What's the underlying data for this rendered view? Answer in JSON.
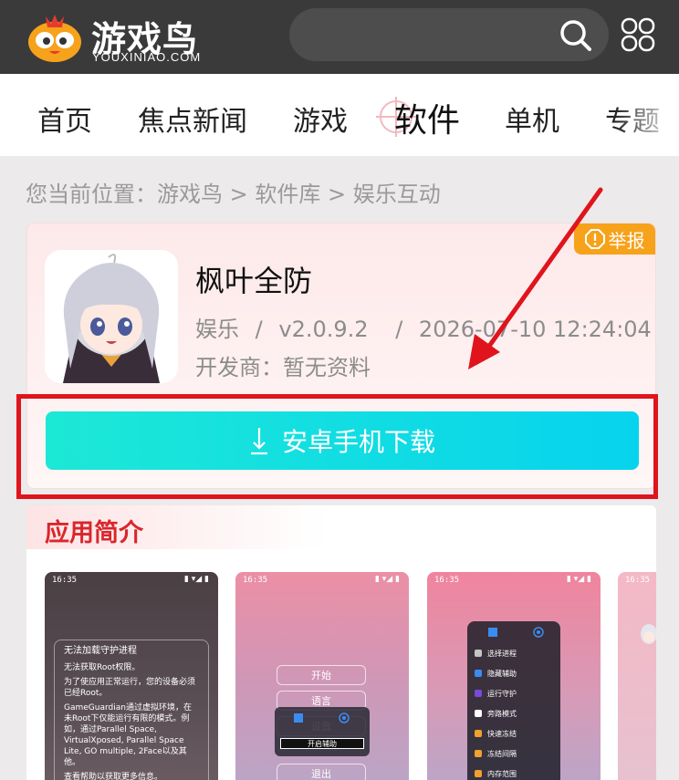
{
  "header": {
    "logo_text": "游戏鸟",
    "logo_sub": "YOUXINIAO.COM",
    "search_value": ""
  },
  "nav": {
    "items": [
      {
        "label": "首页"
      },
      {
        "label": "焦点新闻"
      },
      {
        "label": "游戏"
      },
      {
        "label": "软件",
        "active": true
      },
      {
        "label": "单机"
      },
      {
        "label": "专题"
      }
    ]
  },
  "breadcrumb": {
    "prefix": "您当前位置：",
    "path": [
      "游戏鸟",
      "软件库",
      "娱乐互动"
    ],
    "separator": ">"
  },
  "app": {
    "report_label": "举报",
    "name": "枫叶全防",
    "category": "娱乐",
    "version": "v2.0.9.2",
    "date": "2026-07-10 12:24:04",
    "developer": "开发商：暂无资料",
    "download_label": "安卓手机下载"
  },
  "intro": {
    "title": "应用简介"
  },
  "screenshots": {
    "s1": {
      "time": "16:35",
      "dialog_title": "无法加载守护进程",
      "lines": [
        "无法获取Root权限。",
        "为了使应用正常运行，您的设备必须已经Root。",
        "GameGuardian通过虚拟环境，在未Root下仅能运行有限的模式。例如，通过Parallel Space, VirtualXposed, Parallel Space Lite, GO multiple, 2Face以及其他。",
        "查看帮助以获取更多信息。"
      ]
    },
    "s2": {
      "time": "16:35",
      "buttons": [
        "开始",
        "语言",
        "设置",
        "退出"
      ],
      "float_label": "开启辅助"
    },
    "s3": {
      "time": "16:35",
      "menu": [
        "选择进程",
        "隐藏辅助",
        "运行守护",
        "旁路模式",
        "快速冻结",
        "冻结间隔",
        "内存范围"
      ]
    },
    "s4": {
      "time": "16:35"
    }
  },
  "colors": {
    "topbar": "#3a3a3a",
    "accent_red": "#d9262c",
    "highlight_box": "#e0141c",
    "report_orange": "#f7a21b",
    "download_start": "#1de8d6",
    "download_end": "#07d3ee"
  }
}
